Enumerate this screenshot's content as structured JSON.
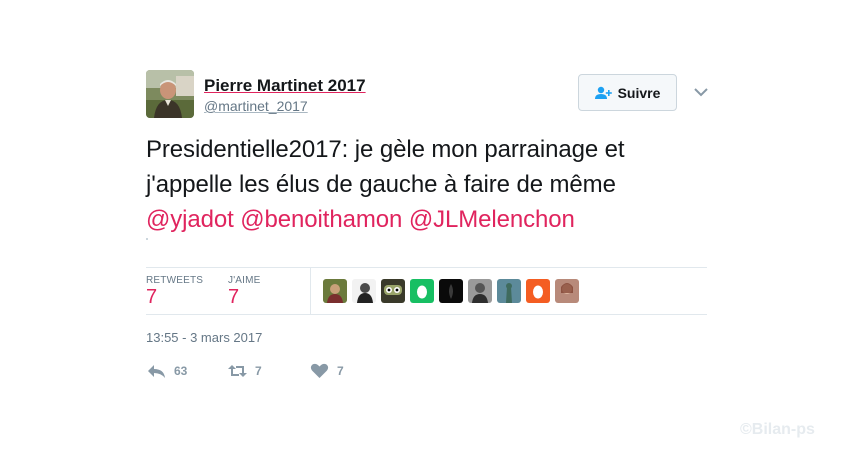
{
  "author": {
    "name": "Pierre Martinet 2017",
    "handle": "@martinet_2017"
  },
  "follow": {
    "label": "Suivre",
    "icon": "add-user-icon",
    "more_icon": "chevron-down-icon"
  },
  "tweet": {
    "line1": "Presidentielle2017: je gèle mon parrainage et",
    "line2": "j'appelle les élus de gauche à faire de même",
    "mentions": [
      "@yjadot",
      "@benoithamon",
      "@JLMelenchon"
    ]
  },
  "stats": {
    "retweets_label": "RETWEETS",
    "retweets_value": "7",
    "likes_label": "J'AIME",
    "likes_value": "7"
  },
  "liker_avatars": [
    {
      "icon": "user-avatar-photo"
    },
    {
      "icon": "user-avatar-bw-portrait"
    },
    {
      "icon": "user-avatar-cartoon"
    },
    {
      "icon": "default-egg-avatar",
      "color": "#17bf63"
    },
    {
      "icon": "user-avatar-dark"
    },
    {
      "icon": "user-avatar-bw"
    },
    {
      "icon": "user-avatar-statue"
    },
    {
      "icon": "default-egg-avatar",
      "color": "#f45d22"
    },
    {
      "icon": "user-avatar-photo"
    }
  ],
  "timestamp": "13:55 - 3 mars 2017",
  "actions": {
    "reply_count": "63",
    "retweet_count": "7",
    "like_count": "7"
  },
  "watermark": "©Bilan-ps",
  "colors": {
    "accent": "#e0245e",
    "muted": "#657786",
    "action": "#8899a6"
  }
}
